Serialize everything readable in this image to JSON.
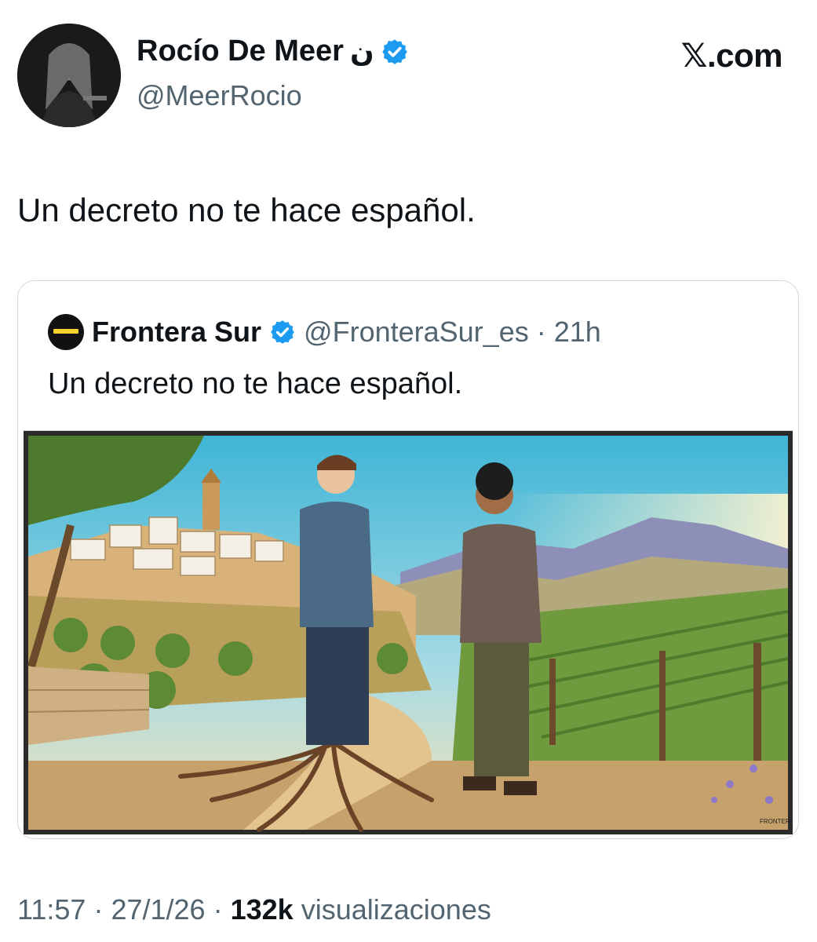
{
  "author": {
    "display_name": "Rocío De Meer",
    "name_symbol": "ن",
    "handle": "@MeerRocio",
    "verified": true
  },
  "brand": "𝕏.com",
  "tweet": {
    "text": "Un decreto no te hace español."
  },
  "quoted": {
    "display_name": "Frontera Sur",
    "handle": "@FronteraSur_es",
    "separator": "·",
    "time": "21h",
    "text": "Un decreto no te hace español.",
    "image_watermark": "FRONTERA SUR"
  },
  "footer": {
    "time": "11:57",
    "sep1": "·",
    "date": "27/1/26",
    "sep2": "·",
    "views_count": "132k",
    "views_label": "visualizaciones"
  },
  "colors": {
    "verified_blue": "#1d9bf0",
    "secondary_text": "#536471",
    "border": "#cfd9de"
  }
}
